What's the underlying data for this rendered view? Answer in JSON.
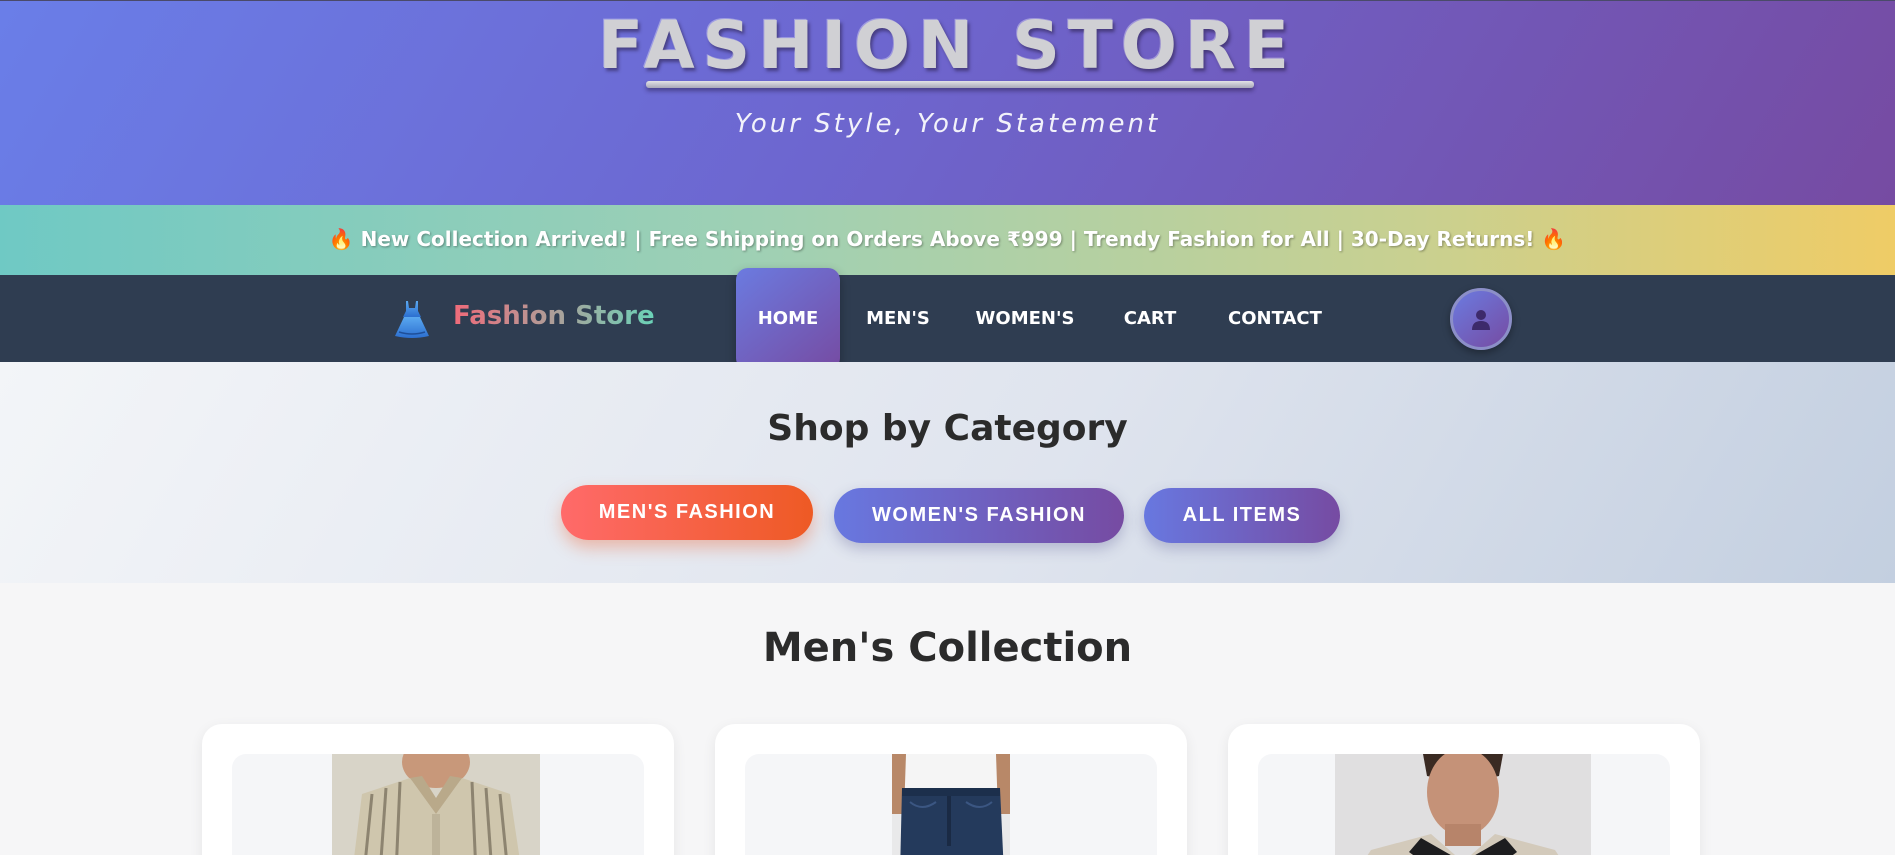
{
  "header": {
    "title": "FASHION STORE",
    "tagline": "Your Style, Your Statement"
  },
  "promo": {
    "icon": "fire-icon",
    "text": "New Collection Arrived! | Free Shipping on Orders Above ₹999 | Trendy Fashion for All | 30-Day Returns!"
  },
  "nav": {
    "brand_icon": "dress-icon",
    "brand": "Fashion Store",
    "items": [
      {
        "label": "HOME",
        "active": true
      },
      {
        "label": "MEN'S",
        "active": false
      },
      {
        "label": "WOMEN'S",
        "active": false
      },
      {
        "label": "CART",
        "active": false
      },
      {
        "label": "CONTACT",
        "active": false
      }
    ],
    "profile_icon": "user-icon"
  },
  "category": {
    "title": "Shop by Category",
    "buttons": [
      "MEN'S FASHION",
      "WOMEN'S FASHION",
      "ALL ITEMS"
    ]
  },
  "collection": {
    "title": "Men's Collection",
    "products": [
      {
        "image": "striped-shirt-photo"
      },
      {
        "image": "jeans-photo"
      },
      {
        "image": "polo-shirt-photo"
      }
    ]
  },
  "colors": {
    "header_gradient": [
      "#667eea",
      "#764ba2"
    ],
    "promo_gradient": [
      "#6fc9c4",
      "#efcc66"
    ],
    "nav_bg": "#2f3d51",
    "hot_button": [
      "#ff6a6a",
      "#ee5a24"
    ]
  }
}
